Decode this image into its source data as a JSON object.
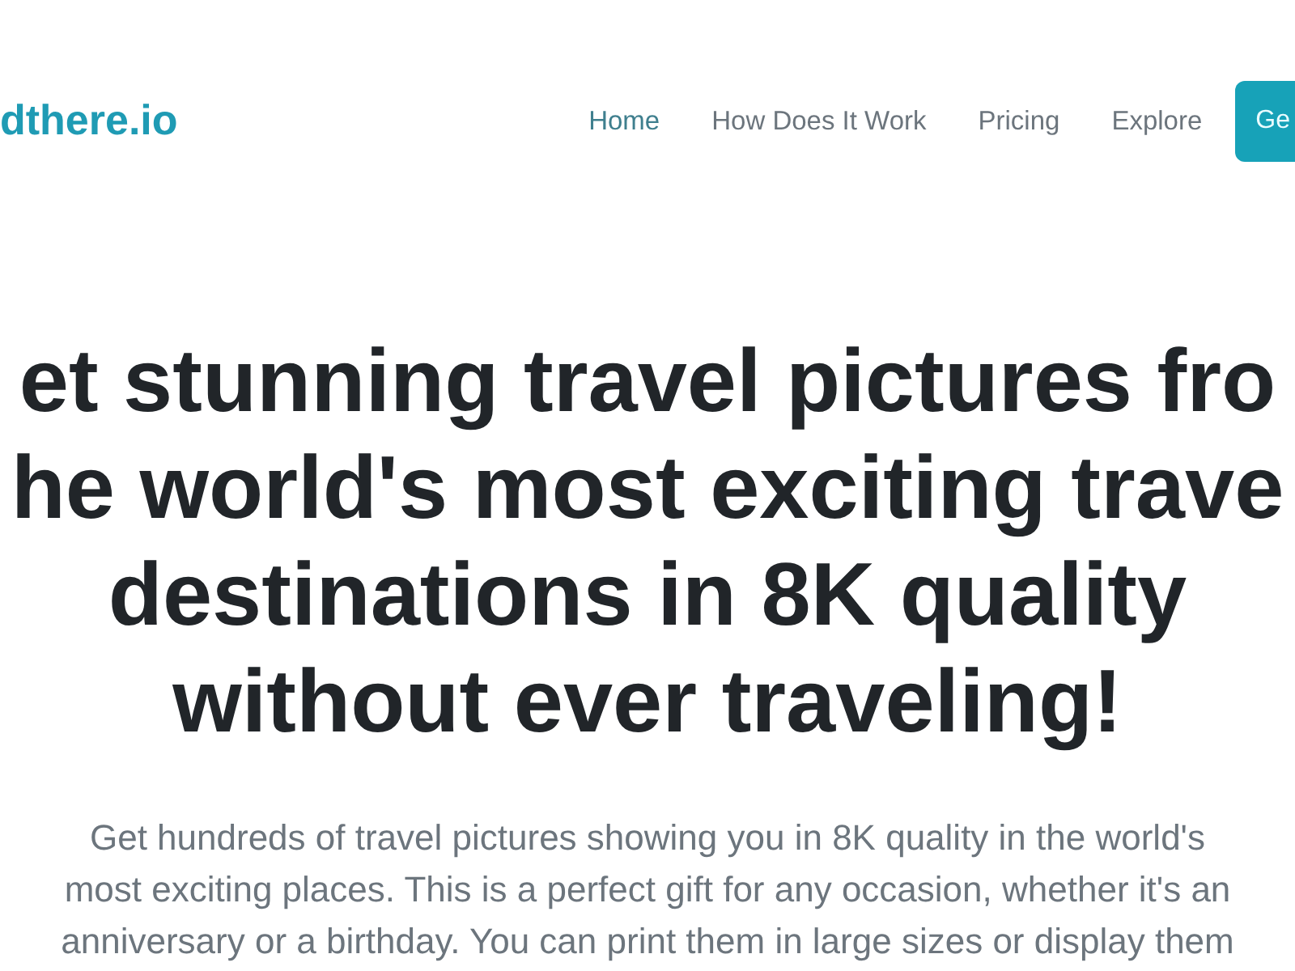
{
  "header": {
    "logo": "dthere.io",
    "nav": [
      {
        "label": "Home",
        "selected": true
      },
      {
        "label": "How Does It Work",
        "selected": false
      },
      {
        "label": "Pricing",
        "selected": false
      },
      {
        "label": "Explore",
        "selected": false
      }
    ],
    "cta_button": "Ge"
  },
  "hero": {
    "headline_lines": [
      "et stunning travel pictures fro",
      "he world's most exciting trave",
      "destinations in 8K quality",
      "without ever traveling!"
    ],
    "description_lines": [
      "Get hundreds of travel pictures showing you in 8K quality in the world's",
      "most exciting places. This is a perfect gift for any occasion, whether it's an",
      "anniversary or a birthday. You can print them in large sizes or display them"
    ]
  }
}
